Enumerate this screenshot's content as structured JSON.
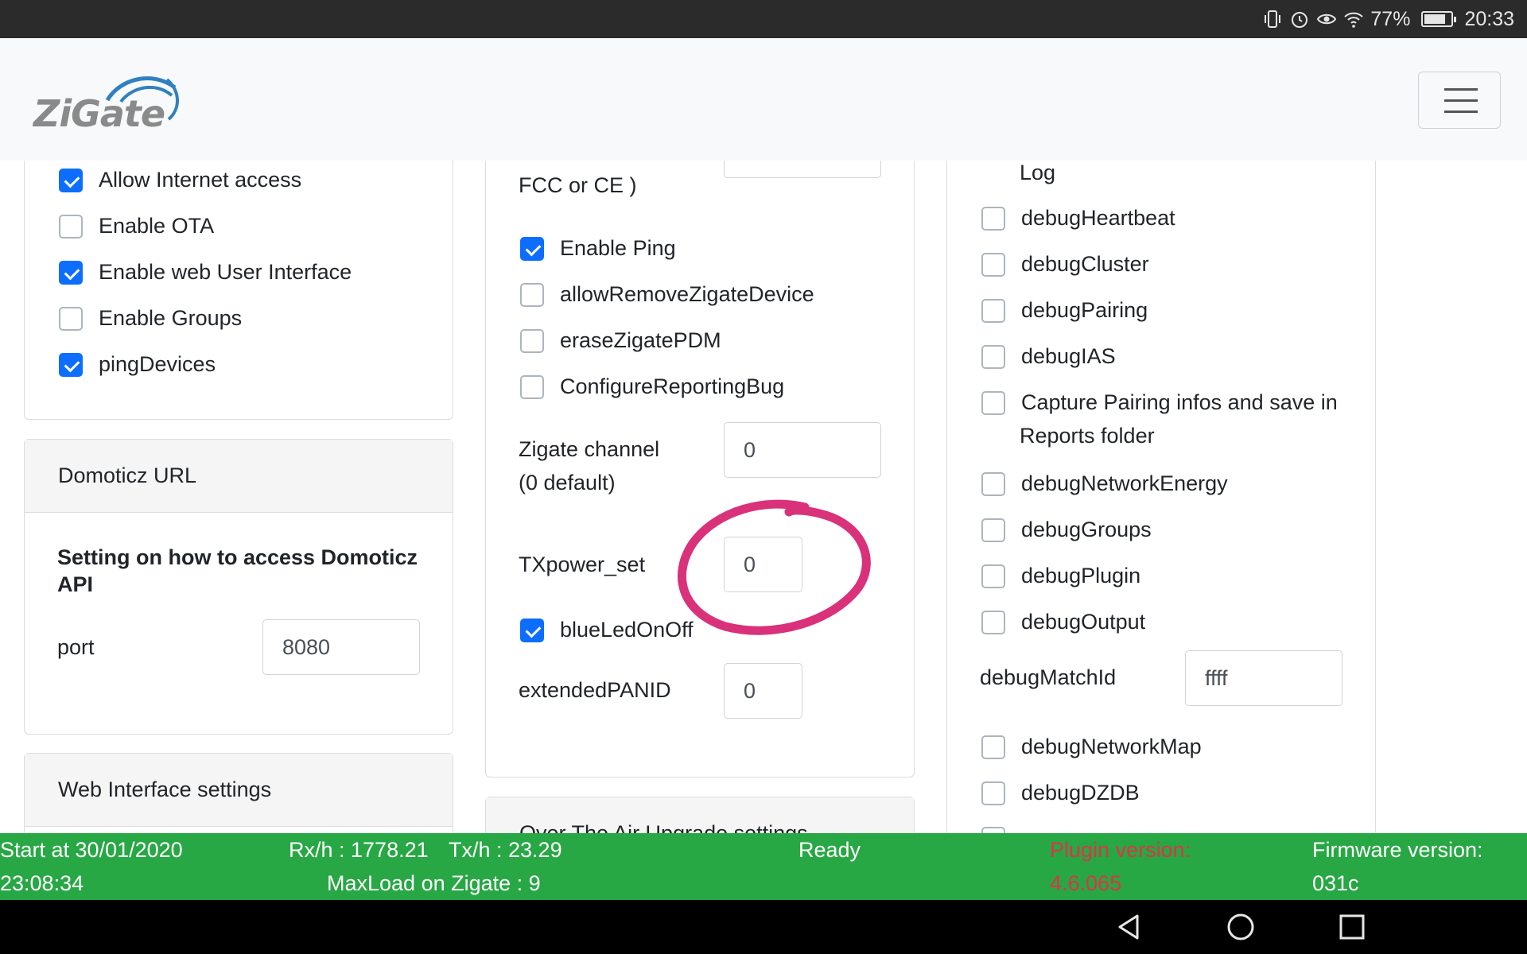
{
  "status_bar": {
    "battery": "77%",
    "time": "20:33"
  },
  "navbar": {
    "logo_text": "ZiGate"
  },
  "col1": {
    "checkboxes": [
      {
        "label": "Allow Internet access",
        "checked": true
      },
      {
        "label": "Enable OTA",
        "checked": false
      },
      {
        "label": "Enable web User Interface",
        "checked": true
      },
      {
        "label": "Enable Groups",
        "checked": false
      },
      {
        "label": "pingDevices",
        "checked": true
      }
    ],
    "domoticz_card": {
      "header": "Domoticz URL",
      "title": "Setting on how to access Domoticz API",
      "port_label": "port",
      "port_value": "8080"
    },
    "web_card": {
      "header": "Web Interface settings"
    }
  },
  "col2": {
    "fcc_label": "FCC or CE )",
    "checkboxes_a": [
      {
        "label": "Enable Ping",
        "checked": true
      },
      {
        "label": "allowRemoveZigateDevice",
        "checked": false
      },
      {
        "label": "eraseZigatePDM",
        "checked": false
      },
      {
        "label": "ConfigureReportingBug",
        "checked": false
      }
    ],
    "channel_label_1": "Zigate channel",
    "channel_label_2": "(0 default)",
    "channel_value": "0",
    "txpower_label": "TXpower_set",
    "txpower_value": "0",
    "blueled": {
      "label": "blueLedOnOff",
      "checked": true
    },
    "panid_label": "extendedPANID",
    "panid_value": "0",
    "ota_card_header": "Over The Air Upgrade settings"
  },
  "col3": {
    "log_label": "Log",
    "checkboxes_a": [
      {
        "label": "debugHeartbeat",
        "checked": false
      },
      {
        "label": "debugCluster",
        "checked": false
      },
      {
        "label": "debugPairing",
        "checked": false
      },
      {
        "label": "debugIAS",
        "checked": false
      }
    ],
    "capture_label_1": "Capture Pairing infos and save in",
    "capture_label_2": "Reports folder",
    "checkboxes_b": [
      {
        "label": "debugNetworkEnergy",
        "checked": false
      },
      {
        "label": "debugGroups",
        "checked": false
      },
      {
        "label": "debugPlugin",
        "checked": false
      },
      {
        "label": "debugOutput",
        "checked": false
      }
    ],
    "matchid_label": "debugMatchId",
    "matchid_value": "ffff",
    "checkboxes_c": [
      {
        "label": "debugNetworkMap",
        "checked": false
      },
      {
        "label": "debugDZDB",
        "checked": false
      }
    ]
  },
  "footer": {
    "start_line1": "Start at 30/01/2020",
    "start_line2": "23:08:34",
    "rx": "Rx/h : 1778.21",
    "tx": "Tx/h : 23.29",
    "maxload": "MaxLoad on Zigate : 9",
    "ready": "Ready",
    "plugin_line1": "Plugin version:",
    "plugin_line2": "4.6.065",
    "firmware_line1": "Firmware version:",
    "firmware_line2": "031c"
  },
  "colors": {
    "accent": "#0d6efd",
    "footer_bg": "#28a745",
    "annotation": "#d9317a"
  }
}
